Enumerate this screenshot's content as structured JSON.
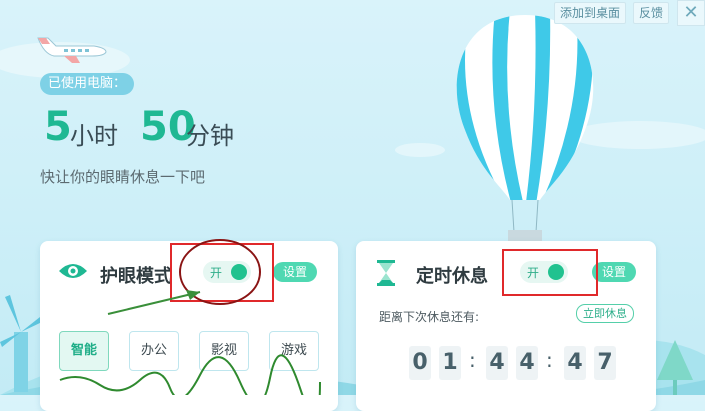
{
  "top": {
    "add_desktop": "添加到桌面",
    "feedback": "反馈",
    "close": "✕"
  },
  "usage": {
    "badge": "已使用电脑：",
    "hours": "5",
    "hours_unit": "小时",
    "minutes": "50",
    "minutes_unit": "分钟",
    "subtitle": "快让你的眼睛休息一下吧"
  },
  "eye_card": {
    "title": "护眼模式",
    "toggle": "开",
    "settings": "设置",
    "modes": [
      "智能",
      "办公",
      "影视",
      "游戏"
    ],
    "active_mode": "智能"
  },
  "rest_card": {
    "title": "定时休息",
    "toggle": "开",
    "settings": "设置",
    "countdown_label": "距离下次休息还有:",
    "rest_now": "立即休息",
    "digits": [
      "0",
      "1",
      "4",
      "4",
      "4",
      "7"
    ]
  },
  "colors": {
    "accent": "#21c28f",
    "text_dark": "#2f3b40",
    "annotation_red": "#e0292b"
  }
}
